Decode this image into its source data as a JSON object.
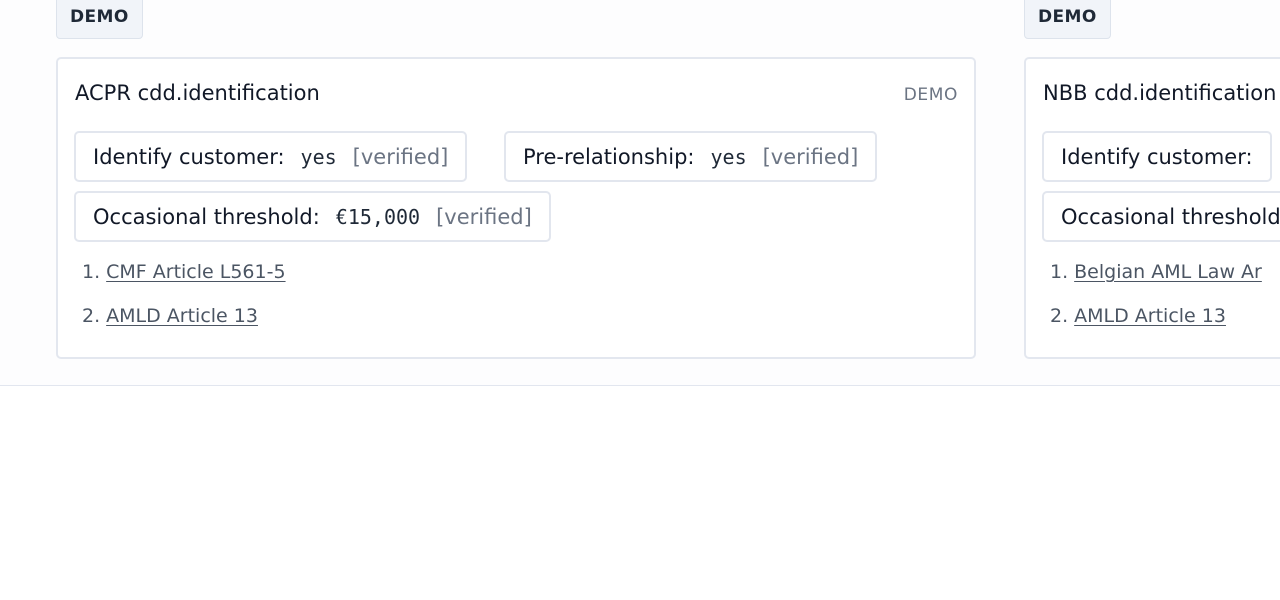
{
  "panels": [
    {
      "chip": "DEMO",
      "title": "ACPR cdd.identification",
      "tag": "DEMO",
      "fields": [
        {
          "label": "Identify customer:",
          "value": "yes",
          "status": "[verified]"
        },
        {
          "label": "Pre-relationship:",
          "value": "yes",
          "status": "[verified]"
        },
        {
          "label": "Occasional threshold:",
          "value": "€15,000",
          "status": "[verified]"
        }
      ],
      "references": [
        {
          "num": "1.",
          "text": "CMF Article L561-5"
        },
        {
          "num": "2.",
          "text": "AMLD Article 13"
        }
      ]
    },
    {
      "chip": "DEMO",
      "title": "NBB cdd.identification",
      "fields": [
        {
          "label": "Identify customer:"
        },
        {
          "label": "Occasional threshold:"
        }
      ],
      "references": [
        {
          "num": "1.",
          "text": "Belgian AML Law Ar"
        },
        {
          "num": "2.",
          "text": "AMLD Article 13"
        }
      ]
    }
  ]
}
